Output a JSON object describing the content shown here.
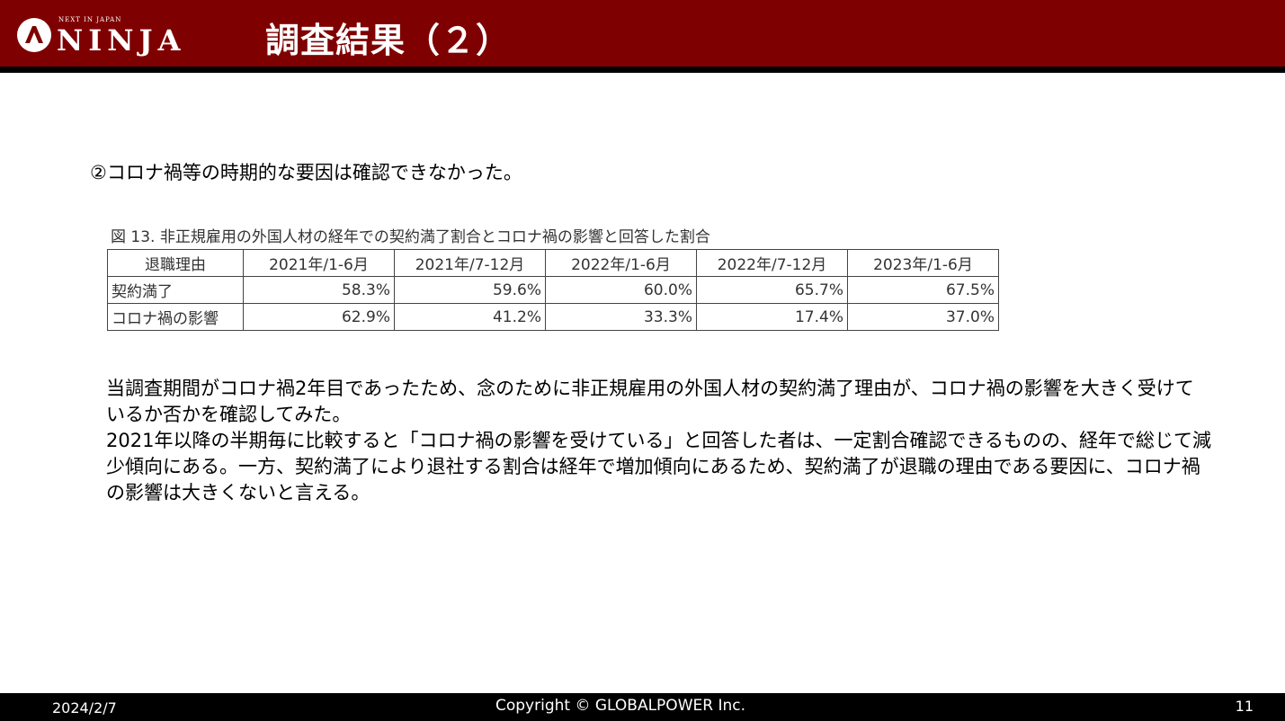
{
  "header": {
    "logo_tagline": "NEXT IN JAPAN",
    "logo_word": "NINJA",
    "title": "調査結果（２）"
  },
  "subtitle": "②コロナ禍等の時期的な要因は確認できなかった。",
  "figure": {
    "caption": "図 13.  非正規雇用の外国人材の経年での契約満了割合とコロナ禍の影響と回答した割合",
    "columns": [
      "退職理由",
      "2021年/1-6月",
      "2021年/7-12月",
      "2022年/1-6月",
      "2022年/7-12月",
      "2023年/1-6月"
    ],
    "rows": [
      {
        "label": "契約満了",
        "values": [
          "58.3%",
          "59.6%",
          "60.0%",
          "65.7%",
          "67.5%"
        ]
      },
      {
        "label": "コロナ禍の影響",
        "values": [
          "62.9%",
          "41.2%",
          "33.3%",
          "17.4%",
          "37.0%"
        ]
      }
    ]
  },
  "body": {
    "line1": "当調査期間がコロナ禍2年目であったため、念のために非正規雇用の外国人材の契約満了理由が、コロナ禍の影響を大きく受けているか否かを確認してみた。",
    "line2": "2021年以降の半期毎に比較すると「コロナ禍の影響を受けている」と回答した者は、一定割合確認できるものの、経年で総じて減少傾向にある。一方、契約満了により退社する割合は経年で増加傾向にあるため、契約満了が退職の理由である要因に、コロナ禍の影響は大きくないと言える。"
  },
  "footer": {
    "date": "2024/2/7",
    "copyright": "Copyright © GLOBALPOWER Inc.",
    "page": "11"
  },
  "colors": {
    "header_bg": "#7f0000",
    "footer_bg": "#000000"
  },
  "icons": {
    "logo": "ninja-logo-icon"
  }
}
